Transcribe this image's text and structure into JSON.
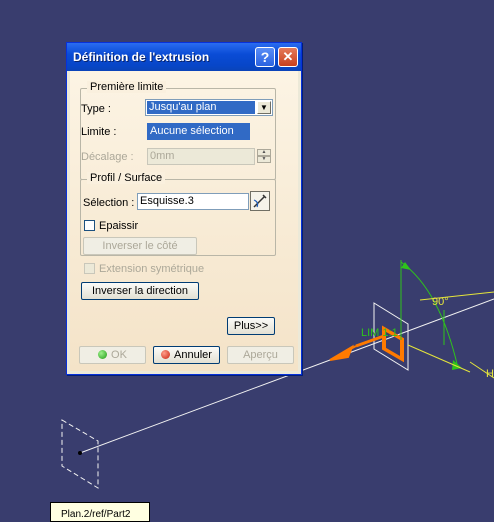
{
  "dialog": {
    "title": "Définition de l'extrusion",
    "help_label": "?",
    "close_label": "✕",
    "first_limit": {
      "legend": "Première limite",
      "type_label": "Type :",
      "type_value": "Jusqu'au plan",
      "limit_label": "Limite :",
      "limit_value": "Aucune sélection",
      "offset_label": "Décalage :",
      "offset_value": "0mm"
    },
    "profile": {
      "legend": "Profil / Surface",
      "selection_label": "Sélection :",
      "selection_value": "Esquisse.3",
      "thicken_label": "Epaissir",
      "invert_side_label": "Inverser le côté"
    },
    "symmetric_label": "Extension symétrique",
    "invert_direction_label": "Inverser la direction",
    "more_label": "Plus>>",
    "ok_label": "OK",
    "cancel_label": "Annuler",
    "preview_label": "Aperçu"
  },
  "viewport": {
    "angle_label": "90°",
    "limit_label": "LIM 1:1",
    "h_label": "H",
    "tooltip": "Plan.2/ref/Part2"
  },
  "colors": {
    "background": "#393d6e",
    "orange": "#ff7a00",
    "green": "#2ec41b",
    "yellow": "#e5e53b"
  }
}
